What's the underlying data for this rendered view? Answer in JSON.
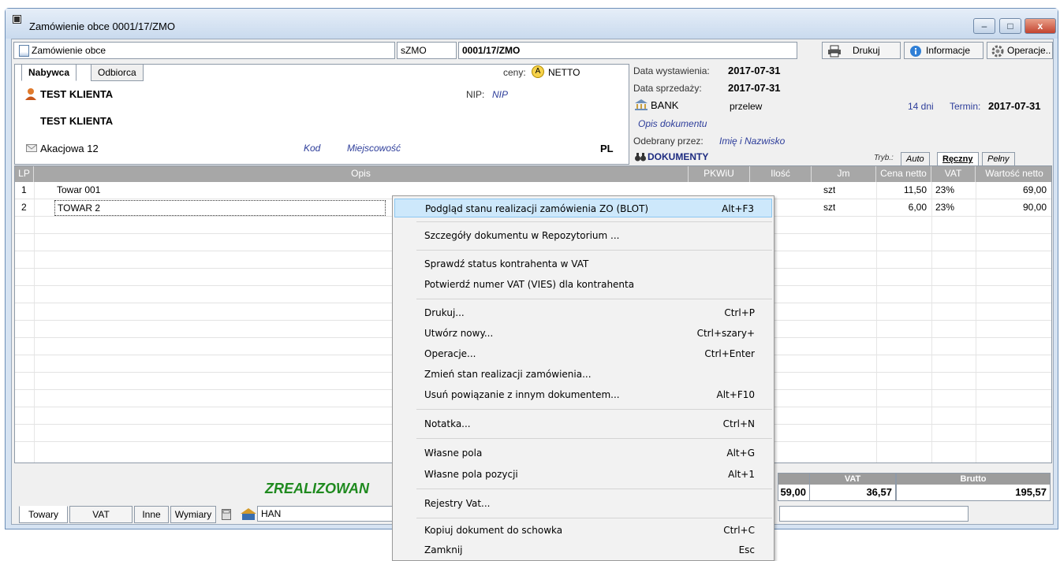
{
  "window": {
    "title": "Zamówienie obce 0001/17/ZMO",
    "btn_min": "–",
    "btn_max": "□",
    "btn_close": "x"
  },
  "strip": {
    "doc_type": "Zamówienie obce",
    "series": "sZMO",
    "number": "0001/17/ZMO",
    "print_label": "Drukuj",
    "info_label": "Informacje",
    "ops_label": "Operacje..",
    "print_icon": "printer-icon",
    "info_icon": "info-icon",
    "ops_icon": "gear-icon"
  },
  "buyer": {
    "tab_buyer": "Nabywca",
    "tab_receiver": "Odbiorca",
    "prices_label": "ceny:",
    "prices_badge": "A",
    "prices_value": "NETTO",
    "name1": "TEST KLIENTA",
    "nip_label": "NIP:",
    "nip_value": "NIP",
    "name2": "TEST KLIENTA",
    "street": "Akacjowa 12",
    "kod": "Kod",
    "city": "Miejscowość",
    "country": "PL"
  },
  "meta": {
    "issue_label": "Data wystawienia:",
    "issue_value": "2017-07-31",
    "sale_label": "Data sprzedaży:",
    "sale_value": "2017-07-31",
    "payment_method": "BANK",
    "payment_type": "przelew",
    "days": "14 dni",
    "term_label": "Termin:",
    "term_value": "2017-07-31",
    "desc": "Opis dokumentu",
    "received_label": "Odebrany przez:",
    "received_value": "Imię i Nazwisko",
    "docs_label": "DOKUMENTY",
    "mode_label": "Tryb.:",
    "mode_auto": "Auto",
    "mode_manual": "Ręczny",
    "mode_full": "Pełny"
  },
  "grid": {
    "headers": [
      "LP",
      "Opis",
      "PKWiU",
      "Ilość",
      "Jm",
      "Cena netto",
      "VAT",
      "Wartość netto"
    ],
    "rows": [
      {
        "lp": "1",
        "opis": "Towar 001",
        "jm": "szt",
        "cena": "11,50",
        "vat": "23%",
        "wartosc": "69,00"
      },
      {
        "lp": "2",
        "opis": "TOWAR 2",
        "jm": "szt",
        "cena": "6,00",
        "vat": "23%",
        "wartosc": "90,00"
      }
    ]
  },
  "bottom": {
    "status": "ZREALIZOWAN",
    "netto_partial": "59,00",
    "vat_label": "VAT",
    "vat_value": "36,57",
    "brutto_label": "Brutto",
    "brutto_value": "195,57",
    "tabs": [
      "Towary",
      "VAT",
      "Inne",
      "Wymiary"
    ],
    "warehouse": "HAN"
  },
  "menu": [
    {
      "label": "Podgląd stanu realizacji zamówienia ZO (BLOT)",
      "shortcut": "Alt+F3"
    },
    {
      "label": "Szczegóły dokumentu w Repozytorium ...",
      "shortcut": ""
    },
    {
      "label": "Sprawdź status kontrahenta w VAT",
      "shortcut": ""
    },
    {
      "label": "Potwierdź numer VAT (VIES) dla kontrahenta",
      "shortcut": ""
    },
    {
      "label": "Drukuj...",
      "shortcut": "Ctrl+P"
    },
    {
      "label": "Utwórz nowy...",
      "shortcut": "Ctrl+szary+"
    },
    {
      "label": "Operacje...",
      "shortcut": "Ctrl+Enter"
    },
    {
      "label": "Zmień stan realizacji zamówienia...",
      "shortcut": ""
    },
    {
      "label": "Usuń powiązanie z innym dokumentem...",
      "shortcut": "Alt+F10"
    },
    {
      "label": "Notatka...",
      "shortcut": "Ctrl+N"
    },
    {
      "label": "Własne pola",
      "shortcut": "Alt+G"
    },
    {
      "label": "Własne pola pozycji",
      "shortcut": "Alt+1"
    },
    {
      "label": "Rejestry Vat...",
      "shortcut": ""
    },
    {
      "label": "Kopiuj dokument do schowka",
      "shortcut": "Ctrl+C"
    },
    {
      "label": "Zamknij",
      "shortcut": "Esc"
    }
  ]
}
